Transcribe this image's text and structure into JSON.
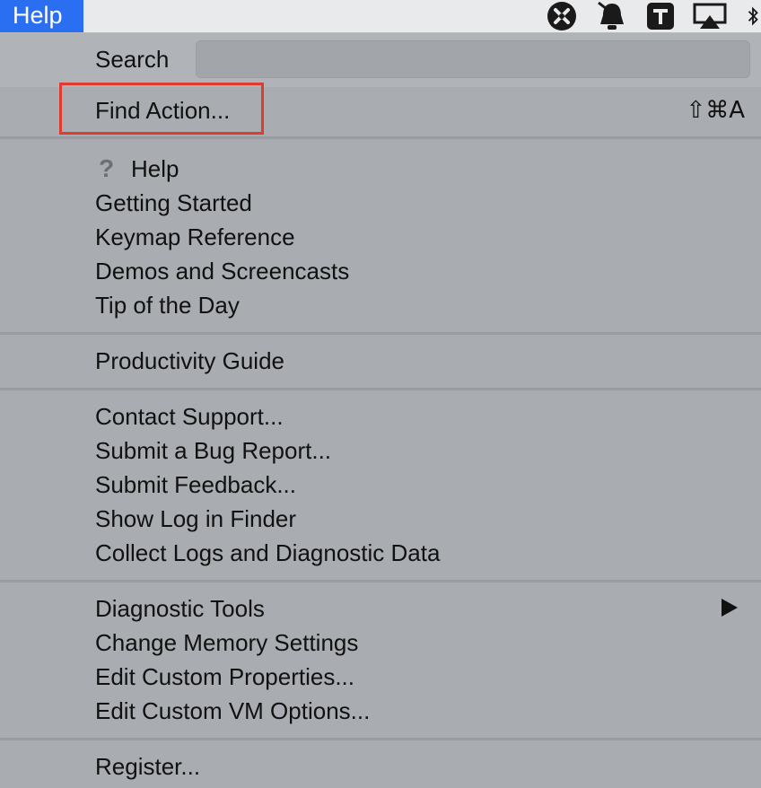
{
  "menubar": {
    "active_menu": "Help",
    "tray_icons": [
      "tools-icon",
      "bell-icon",
      "t-app-icon",
      "airplay-icon",
      "bluetooth-icon"
    ]
  },
  "search": {
    "label": "Search",
    "value": ""
  },
  "find_action": {
    "label": "Find Action...",
    "shortcut": "⇧⌘A"
  },
  "group_help": {
    "help_icon": "?",
    "items": [
      "Help",
      "Getting Started",
      "Keymap Reference",
      "Demos and Screencasts",
      "Tip of the Day"
    ]
  },
  "group_productivity": {
    "items": [
      "Productivity Guide"
    ]
  },
  "group_support": {
    "items": [
      "Contact Support...",
      "Submit a Bug Report...",
      "Submit Feedback...",
      "Show Log in Finder",
      "Collect Logs and Diagnostic Data"
    ]
  },
  "group_tools": {
    "items": [
      "Diagnostic Tools",
      "Change Memory Settings",
      "Edit Custom Properties...",
      "Edit Custom VM Options..."
    ]
  },
  "group_register": {
    "items": [
      "Register..."
    ]
  }
}
